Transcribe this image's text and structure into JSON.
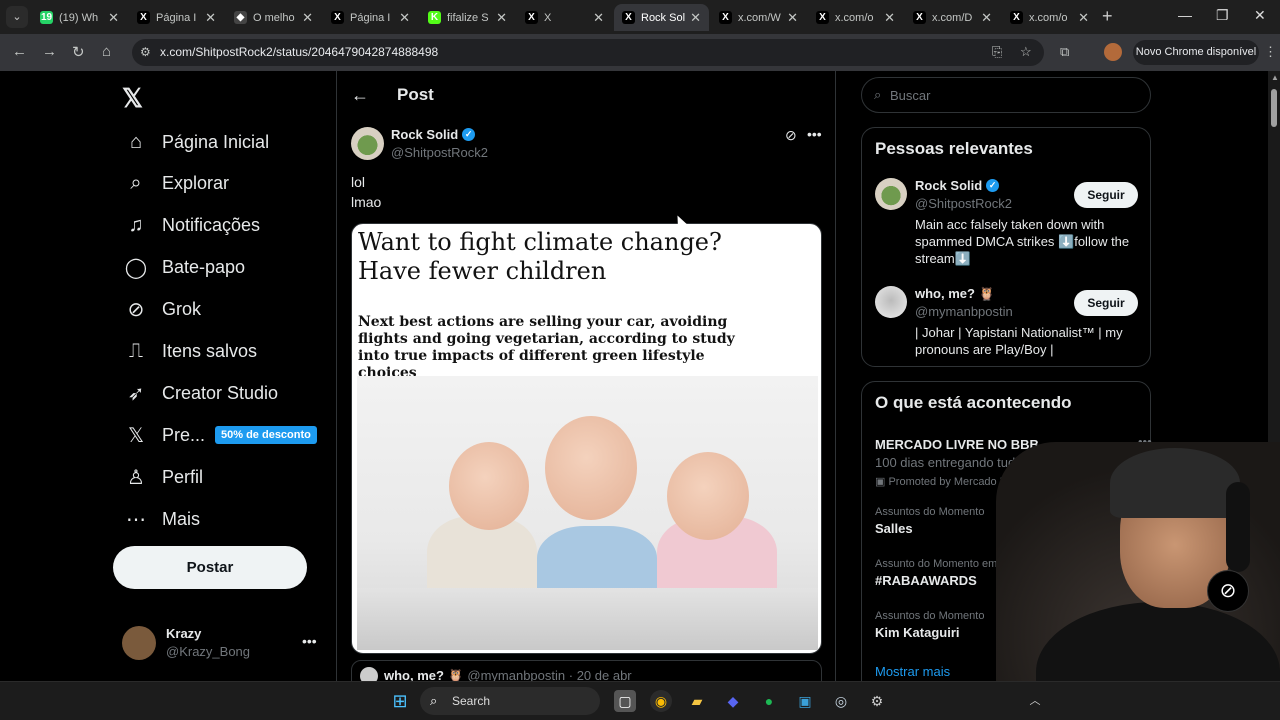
{
  "browser": {
    "tabs": [
      {
        "title": "(19) Wh",
        "favicon": "whatsapp-icon",
        "badge": "19",
        "color": "#25d366"
      },
      {
        "title": "Página I",
        "favicon": "x-icon",
        "color": "#000000"
      },
      {
        "title": "O melho",
        "favicon": "shield-icon",
        "color": "#444444"
      },
      {
        "title": "Página I",
        "favicon": "x-icon",
        "color": "#000000"
      },
      {
        "title": "fifalize S",
        "favicon": "k-icon",
        "color": "#53fc18"
      },
      {
        "title": "X",
        "favicon": "x-icon",
        "color": "#000000"
      },
      {
        "title": "Rock Sol",
        "favicon": "x-icon",
        "color": "#000000",
        "active": true
      },
      {
        "title": "x.com/W",
        "favicon": "x-icon",
        "color": "#000000"
      },
      {
        "title": "x.com/o",
        "favicon": "x-icon",
        "color": "#000000"
      },
      {
        "title": "x.com/D",
        "favicon": "x-icon",
        "color": "#000000"
      },
      {
        "title": "x.com/o",
        "favicon": "x-icon",
        "color": "#000000"
      }
    ],
    "url": "x.com/ShitpostRock2/status/2046479042874888498",
    "update_label": "Novo Chrome disponível"
  },
  "nav": {
    "items": [
      {
        "label": "Página Inicial",
        "icon": "home-icon"
      },
      {
        "label": "Explorar",
        "icon": "search-icon"
      },
      {
        "label": "Notificações",
        "icon": "bell-icon"
      },
      {
        "label": "Bate-papo",
        "icon": "chat-icon"
      },
      {
        "label": "Grok",
        "icon": "grok-icon"
      },
      {
        "label": "Itens salvos",
        "icon": "bookmark-icon"
      },
      {
        "label": "Creator Studio",
        "icon": "rocket-icon"
      },
      {
        "label": "Pre...",
        "icon": "x-icon",
        "badge": "50% de desconto"
      },
      {
        "label": "Perfil",
        "icon": "person-icon"
      },
      {
        "label": "Mais",
        "icon": "more-circle-icon"
      }
    ],
    "post_button": "Postar",
    "account": {
      "name": "Krazy",
      "handle": "@Krazy_Bong"
    }
  },
  "post": {
    "header": "Post",
    "author": {
      "name": "Rock Solid",
      "handle": "@ShitpostRock2"
    },
    "text_lines": [
      "lol",
      "lmao"
    ],
    "card": {
      "headline": "Want to fight climate change? Have fewer children",
      "subhead": "Next best actions are selling your car, avoiding flights and going vegetarian, according to study into true impacts of different green lifestyle choices"
    },
    "reply_preview": {
      "name": "who, me? 🦉",
      "handle": "@mymanbpostin",
      "time": "· 20 de abr"
    }
  },
  "sidebar": {
    "search_placeholder": "Buscar",
    "relevant": {
      "title": "Pessoas relevantes",
      "people": [
        {
          "name": "Rock Solid",
          "verified": true,
          "handle": "@ShitpostRock2",
          "bio": "Main acc falsely taken down with spammed DMCA strikes ⬇️follow the stream⬇️",
          "follow": "Seguir"
        },
        {
          "name": "who, me? 🦉",
          "verified": false,
          "handle": "@mymanbpostin",
          "bio": "| Johar | Yapistani Nationalist™ | my pronouns are Play/Boy |",
          "follow": "Seguir"
        }
      ]
    },
    "trends": {
      "title": "O que está acontecendo",
      "items": [
        {
          "context": "",
          "title": "MERCADO LIVRE NO BBB",
          "desc": "100 dias entregando tudo!",
          "promo": "Promoted by Mercado Livre Brasil"
        },
        {
          "context": "Assuntos do Momento",
          "title": "Salles"
        },
        {
          "context": "Assunto do Momento em Brasil",
          "title": "#RABAAWARDS"
        },
        {
          "context": "Assuntos do Momento",
          "title": "Kim Kataguiri"
        }
      ],
      "show_more": "Mostrar mais"
    }
  },
  "taskbar": {
    "search_placeholder": "Search"
  },
  "colors": {
    "accent": "#1d9bf0",
    "background": "#000000"
  }
}
